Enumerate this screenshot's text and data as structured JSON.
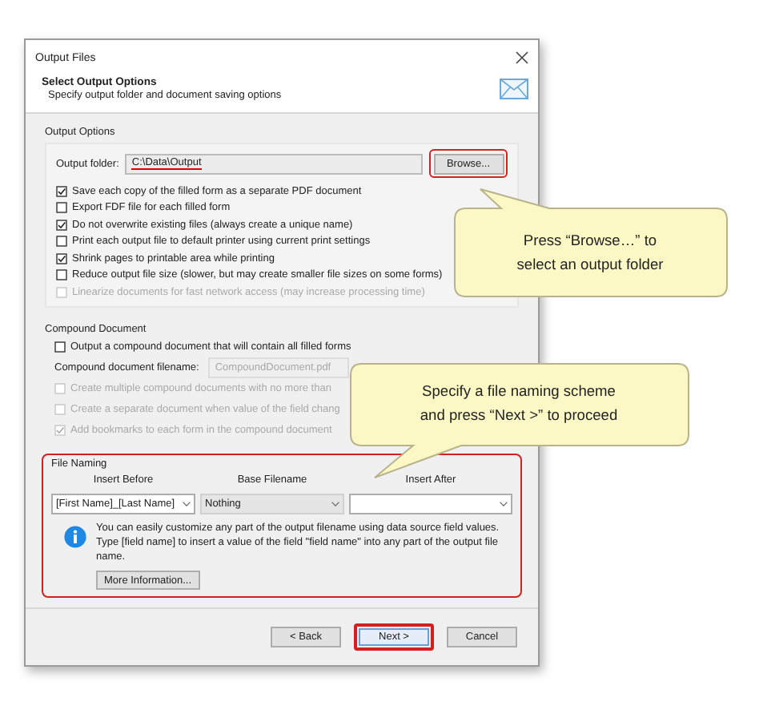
{
  "window": {
    "title": "Output Files"
  },
  "header": {
    "title": "Select Output Options",
    "subtitle": "Specify output folder and document saving options"
  },
  "output_options": {
    "title": "Output Options",
    "folder_label": "Output folder:",
    "folder_value": "C:\\Data\\Output",
    "folder_highlighted": true,
    "browse_button": {
      "label": "Browse...",
      "highlighted": true
    },
    "options": [
      {
        "label": "Save each copy of the filled form as a separate PDF document",
        "checked": true,
        "disabled": false
      },
      {
        "label": "Export FDF file for each filled form",
        "checked": false,
        "disabled": false
      },
      {
        "label": "Do not overwrite existing files (always create a unique name)",
        "checked": true,
        "disabled": false
      },
      {
        "label": "Print each output file to default printer using current print settings",
        "checked": false,
        "disabled": false
      },
      {
        "label": "Shrink pages to printable area while printing",
        "checked": true,
        "disabled": false
      },
      {
        "label": "Reduce output file size (slower, but may create smaller file sizes on some forms)",
        "checked": false,
        "disabled": false
      },
      {
        "label": "Linearize documents for fast network access (may increase processing time)",
        "checked": false,
        "disabled": true
      }
    ]
  },
  "compound_document": {
    "title": "Compound Document",
    "output_option": {
      "label": "Output a compound document that will contain all filled forms",
      "checked": false,
      "disabled": false
    },
    "filename_label": "Compound document filename:",
    "filename_value": "CompoundDocument.pdf",
    "filename_disabled": true,
    "options": [
      {
        "label": "Create multiple compound documents with no more than",
        "checked": false,
        "disabled": true
      },
      {
        "label": "Create a separate document when value of the field chang",
        "checked": false,
        "disabled": true
      },
      {
        "label": "Add bookmarks to each form in the compound document",
        "checked": true,
        "disabled": true
      }
    ]
  },
  "file_naming": {
    "title": "File Naming",
    "highlighted": true,
    "columns": [
      {
        "header": "Insert Before",
        "kind": "editable",
        "value": "[First Name]_[Last Name]"
      },
      {
        "header": "Base Filename",
        "kind": "list",
        "value": "Nothing"
      },
      {
        "header": "Insert After",
        "kind": "editable"
      }
    ],
    "info": "You can easily customize any part of the output filename using data source field values. Type [field name] to insert a value of the field \"field name\" into any part of the output file name.",
    "more_button": "More Information..."
  },
  "buttons": [
    {
      "label": "< Back",
      "highlighted": false
    },
    {
      "label": "Next >",
      "highlighted": true
    },
    {
      "label": "Cancel",
      "highlighted": false
    }
  ],
  "callouts": [
    {
      "lines": [
        "Press “Browse…” to",
        "select an output folder"
      ]
    },
    {
      "lines": [
        "Specify a file naming scheme",
        "and press “Next >” to proceed"
      ]
    }
  ]
}
